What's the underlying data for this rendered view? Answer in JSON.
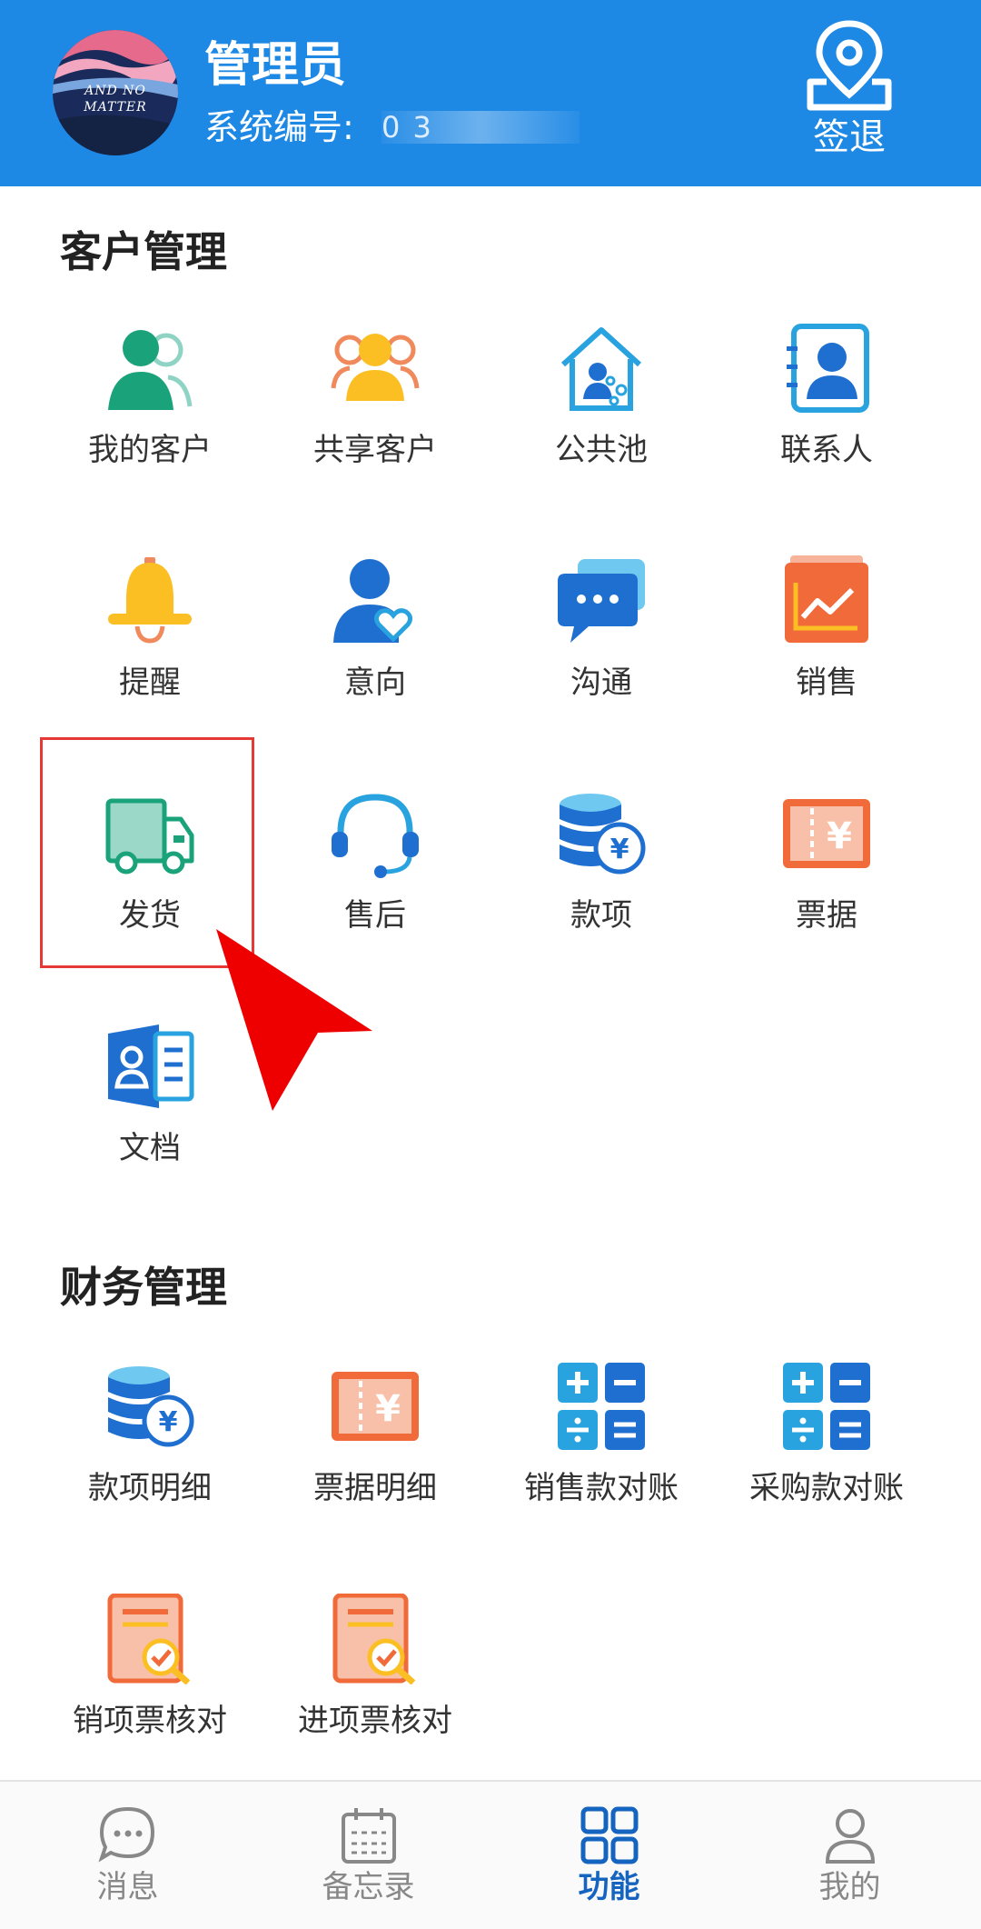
{
  "header": {
    "admin_name": "管理员",
    "system_id_label": "系统编号:",
    "system_id_value": "0 3",
    "signout_label": "签退",
    "avatar_text": "AND NO MATTER"
  },
  "sections": {
    "customer": {
      "title": "客户管理",
      "items": [
        {
          "label": "我的客户",
          "icon": "my-customers-icon"
        },
        {
          "label": "共享客户",
          "icon": "shared-customers-icon"
        },
        {
          "label": "公共池",
          "icon": "public-pool-icon"
        },
        {
          "label": "联系人",
          "icon": "contacts-icon"
        },
        {
          "label": "提醒",
          "icon": "bell-icon"
        },
        {
          "label": "意向",
          "icon": "intention-icon"
        },
        {
          "label": "沟通",
          "icon": "chat-icon"
        },
        {
          "label": "销售",
          "icon": "sales-chart-icon"
        },
        {
          "label": "发货",
          "icon": "truck-icon"
        },
        {
          "label": "售后",
          "icon": "headset-icon"
        },
        {
          "label": "款项",
          "icon": "coins-yen-icon"
        },
        {
          "label": "票据",
          "icon": "bill-icon"
        },
        {
          "label": "文档",
          "icon": "document-icon"
        }
      ]
    },
    "finance": {
      "title": "财务管理",
      "items": [
        {
          "label": "款项明细",
          "icon": "coins-yen-icon"
        },
        {
          "label": "票据明细",
          "icon": "bill-icon"
        },
        {
          "label": "销售款对账",
          "icon": "calculator-icon"
        },
        {
          "label": "采购款对账",
          "icon": "calculator-icon"
        },
        {
          "label": "销项票核对",
          "icon": "invoice-check-icon"
        },
        {
          "label": "进项票核对",
          "icon": "invoice-check-icon"
        }
      ]
    }
  },
  "bottom_nav": [
    {
      "label": "消息",
      "icon": "message-icon",
      "active": false
    },
    {
      "label": "备忘录",
      "icon": "calendar-icon",
      "active": false
    },
    {
      "label": "功能",
      "icon": "grid-icon",
      "active": true
    },
    {
      "label": "我的",
      "icon": "person-icon",
      "active": false
    }
  ],
  "colors": {
    "header_bg": "#1E88E5",
    "highlight": "#E53935",
    "nav_active": "#1565C0",
    "nav_inactive": "#888888"
  },
  "annotation": {
    "highlighted_item": "发货"
  }
}
